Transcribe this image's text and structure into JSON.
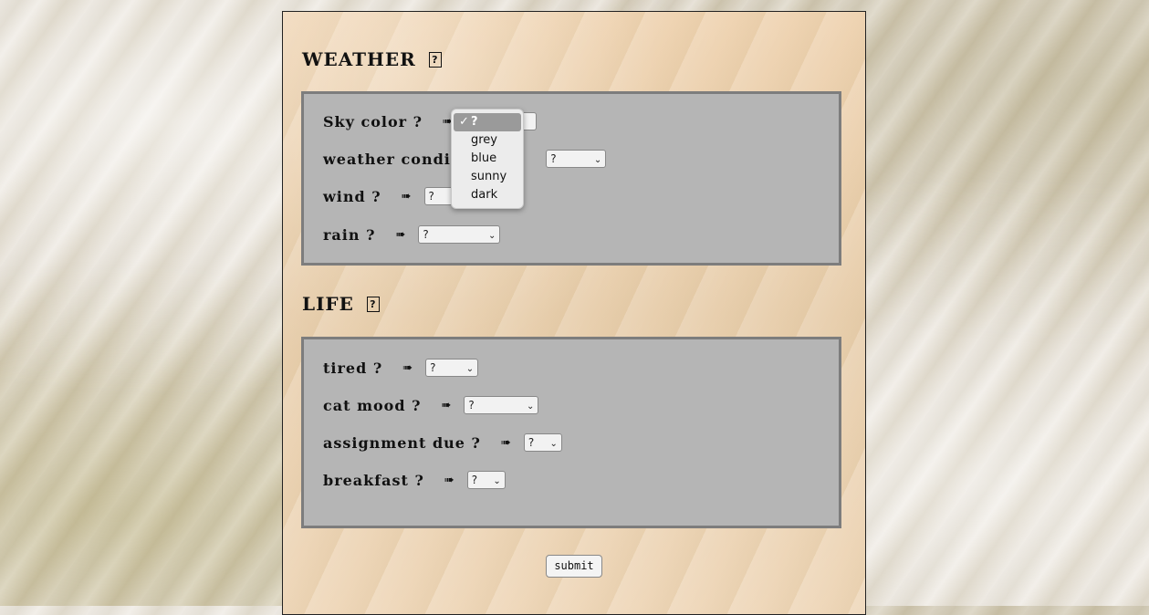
{
  "weather": {
    "heading": "WEATHER",
    "help_icon": "?",
    "rows": [
      {
        "label": "Sky color ?",
        "arrow": "➠",
        "value": "?"
      },
      {
        "label": "weather condit",
        "arrow": "",
        "value": "?"
      },
      {
        "label": "wind ?",
        "arrow": "➠",
        "value": "?"
      },
      {
        "label": "rain ?",
        "arrow": "➠",
        "value": "?"
      }
    ]
  },
  "life": {
    "heading": "LIFE",
    "help_icon": "?",
    "rows": [
      {
        "label": "tired ?",
        "arrow": "➠",
        "value": "?"
      },
      {
        "label": "cat mood ?",
        "arrow": "➠",
        "value": "?"
      },
      {
        "label": "assignment due ?",
        "arrow": "➠",
        "value": "?"
      },
      {
        "label": "breakfast ?",
        "arrow": "➠",
        "value": "?"
      }
    ]
  },
  "sky_dropdown": {
    "check": "✓",
    "options": [
      "?",
      "grey",
      "blue",
      "sunny",
      "dark"
    ]
  },
  "submit_label": "submit",
  "colors": {
    "panel": "#b5b5b5",
    "panel_border": "#7d7d7d",
    "page": "#e8cfae"
  }
}
